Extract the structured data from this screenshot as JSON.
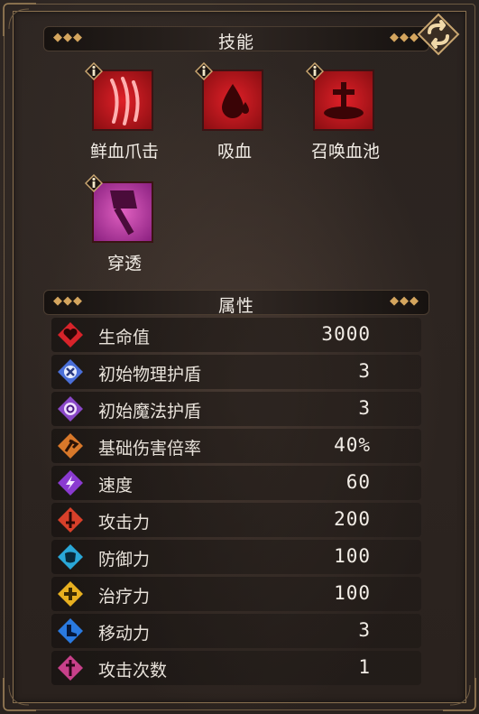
{
  "skills_section": {
    "title": "技能",
    "skills": [
      {
        "name": "鲜血爪击",
        "icon": "blood-claw-icon"
      },
      {
        "name": "吸血",
        "icon": "blood-drop-icon"
      },
      {
        "name": "召唤血池",
        "icon": "blood-pool-summon-icon"
      },
      {
        "name": "穿透",
        "icon": "hammer-pierce-icon"
      }
    ]
  },
  "attributes_section": {
    "title": "属性",
    "rows": [
      {
        "label": "生命值",
        "value": "3000",
        "icon": "heart-icon",
        "color": "#d8232a"
      },
      {
        "label": "初始物理护盾",
        "value": "3",
        "icon": "physical-shield-icon",
        "color": "#4a6fd8"
      },
      {
        "label": "初始魔法护盾",
        "value": "3",
        "icon": "magic-shield-icon",
        "color": "#8a48c8"
      },
      {
        "label": "基础伤害倍率",
        "value": "40%",
        "icon": "damage-multiplier-icon",
        "color": "#d8782a"
      },
      {
        "label": "速度",
        "value": "60",
        "icon": "speed-icon",
        "color": "#8a3ad0"
      },
      {
        "label": "攻击力",
        "value": "200",
        "icon": "attack-sword-icon",
        "color": "#d8402a"
      },
      {
        "label": "防御力",
        "value": "100",
        "icon": "defense-armor-icon",
        "color": "#2aa8d8"
      },
      {
        "label": "治疗力",
        "value": "100",
        "icon": "heal-cross-icon",
        "color": "#e8b020"
      },
      {
        "label": "移动力",
        "value": "3",
        "icon": "move-boot-icon",
        "color": "#2a7ae0"
      },
      {
        "label": "攻击次数",
        "value": "1",
        "icon": "attack-count-icon",
        "color": "#c8408a"
      }
    ]
  },
  "swap_button": {
    "icon": "swap-arrows-icon"
  },
  "colors": {
    "frame": "#8a7150",
    "accent_gold": "#d4a55e",
    "skill_red": "#c8141e",
    "skill_magenta": "#c03aa0"
  }
}
